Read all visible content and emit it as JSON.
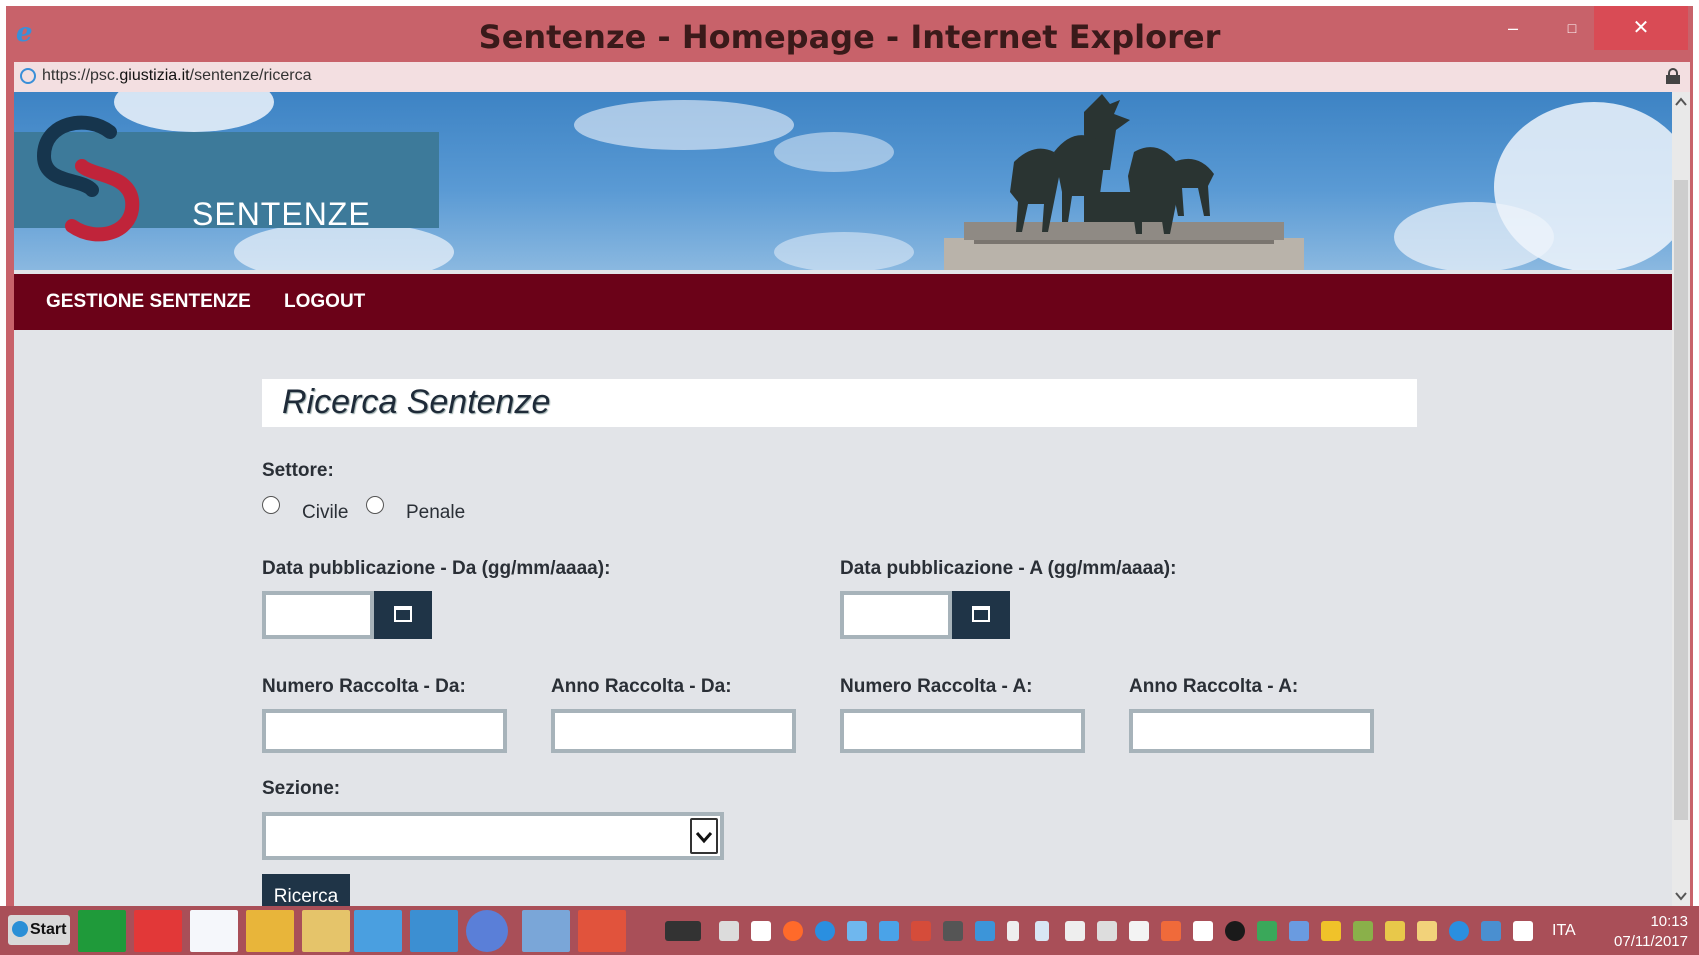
{
  "window": {
    "title": "Sentenze - Homepage - Internet Explorer",
    "url_prefix": "https://psc.",
    "url_domain": "giustizia.it",
    "url_path": "/sentenze/ricerca",
    "controls": {
      "minimize": "–",
      "maximize": "□",
      "close": "✕"
    }
  },
  "header": {
    "logo_text": "SENTENZE",
    "nav": [
      {
        "label": "GESTIONE SENTENZE"
      },
      {
        "label": "LOGOUT"
      }
    ]
  },
  "search": {
    "title": "Ricerca Sentenze",
    "settore_label": "Settore:",
    "settore_options": [
      "Civile",
      "Penale"
    ],
    "data_da_label": "Data pubblicazione - Da (gg/mm/aaaa):",
    "data_a_label": "Data pubblicazione - A (gg/mm/aaaa):",
    "data_da_value": "",
    "data_a_value": "",
    "numero_da_label": "Numero Raccolta - Da:",
    "anno_da_label": "Anno Raccolta - Da:",
    "numero_a_label": "Numero Raccolta - A:",
    "anno_a_label": "Anno Raccolta - A:",
    "numero_da_value": "",
    "anno_da_value": "",
    "numero_a_value": "",
    "anno_a_value": "",
    "sezione_label": "Sezione:",
    "sezione_value": "",
    "submit_label": "Ricerca"
  },
  "taskbar": {
    "start_label": "Start",
    "language": "ITA",
    "time": "10:13",
    "date": "07/11/2017"
  },
  "colors": {
    "titlebar": "#c8626a",
    "nav": "#6b0218",
    "button": "#1f3447",
    "page_bg": "#e2e4e8"
  }
}
